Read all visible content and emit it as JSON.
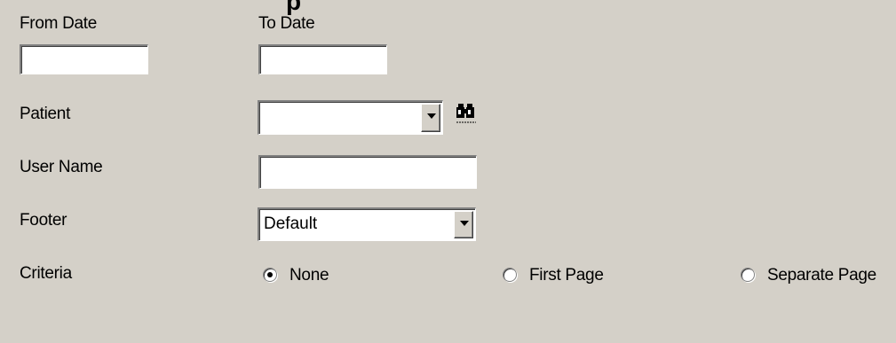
{
  "form": {
    "from_date": {
      "label": "From Date",
      "value": ""
    },
    "to_date": {
      "label": "To Date",
      "value": ""
    },
    "patient": {
      "label": "Patient",
      "selected": ""
    },
    "user_name": {
      "label": "User Name",
      "value": ""
    },
    "footer": {
      "label": "Footer",
      "selected": "Default"
    },
    "criteria": {
      "label": "Criteria",
      "options": [
        "None",
        "First Page",
        "Separate Page"
      ],
      "selected": "None"
    }
  },
  "icons": {
    "patient_search": "binoculars-icon"
  }
}
